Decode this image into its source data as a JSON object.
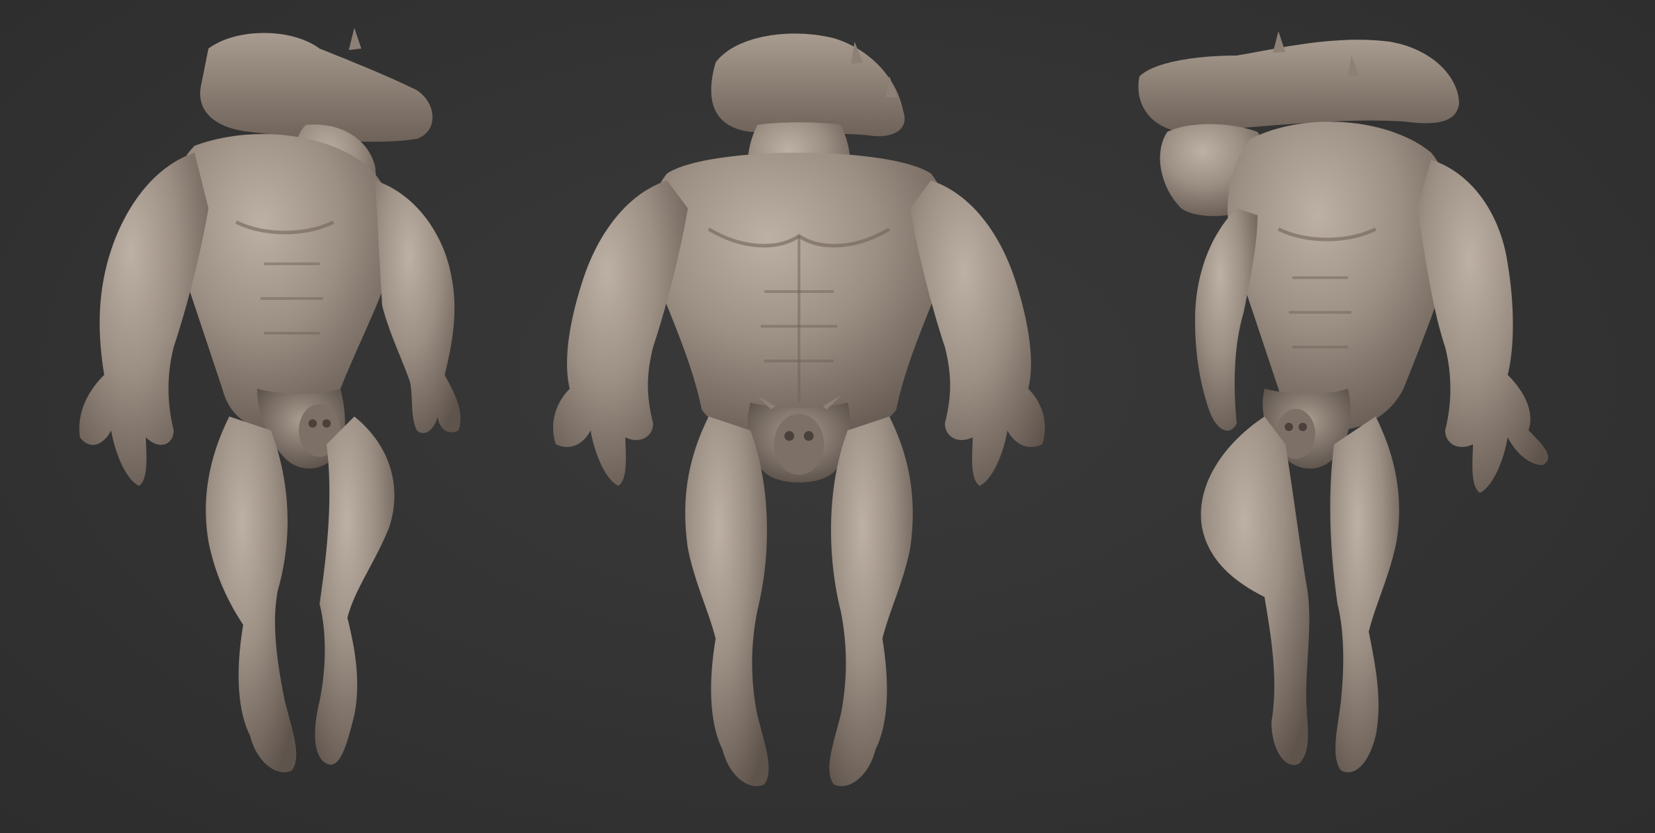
{
  "scene": {
    "background_color": "#333333",
    "clay_color": "#9c8f84",
    "clay_highlight": "#b9aca0",
    "clay_shadow": "#5f544c",
    "views": [
      {
        "name": "three-quarter-left"
      },
      {
        "name": "front"
      },
      {
        "name": "three-quarter-right"
      }
    ]
  }
}
